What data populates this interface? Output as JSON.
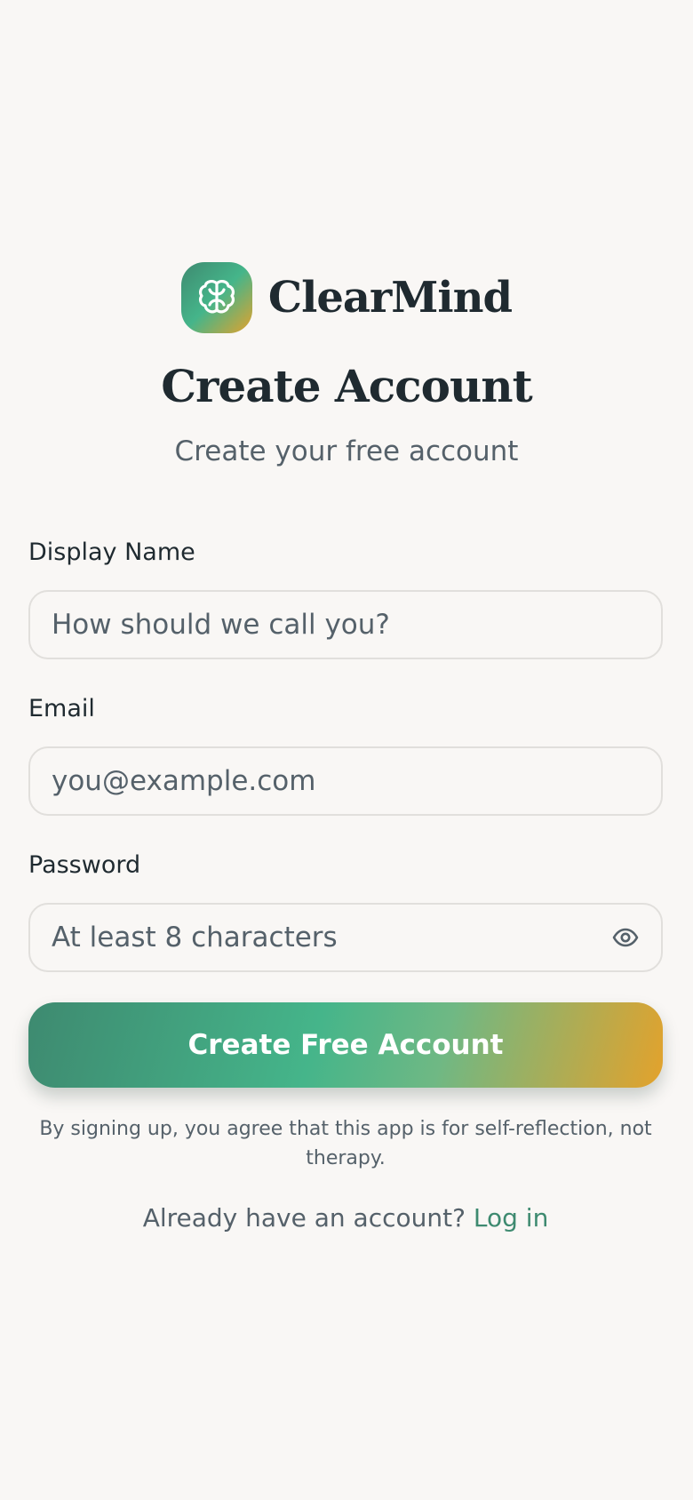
{
  "app": {
    "name": "ClearMind",
    "logo_icon": "brain-icon",
    "brand_gradient": [
      "#3e8a70",
      "#45b58a",
      "#e3a22c"
    ]
  },
  "header": {
    "title": "Create Account",
    "subtitle": "Create your free account"
  },
  "form": {
    "display_name": {
      "label": "Display Name",
      "placeholder": "How should we call you?",
      "value": ""
    },
    "email": {
      "label": "Email",
      "placeholder": "you@example.com",
      "value": ""
    },
    "password": {
      "label": "Password",
      "placeholder": "At least 8 characters",
      "value": "",
      "toggle_icon": "eye-icon"
    },
    "submit_label": "Create Free Account",
    "disclaimer": "By signing up, you agree that this app is for self-reflection, not therapy."
  },
  "footer": {
    "prompt": "Already have an account?",
    "login_label": "Log in"
  },
  "colors": {
    "background": "#f9f7f5",
    "text_primary": "#1f2a30",
    "text_secondary": "#55616a",
    "accent": "#3e8a70"
  }
}
